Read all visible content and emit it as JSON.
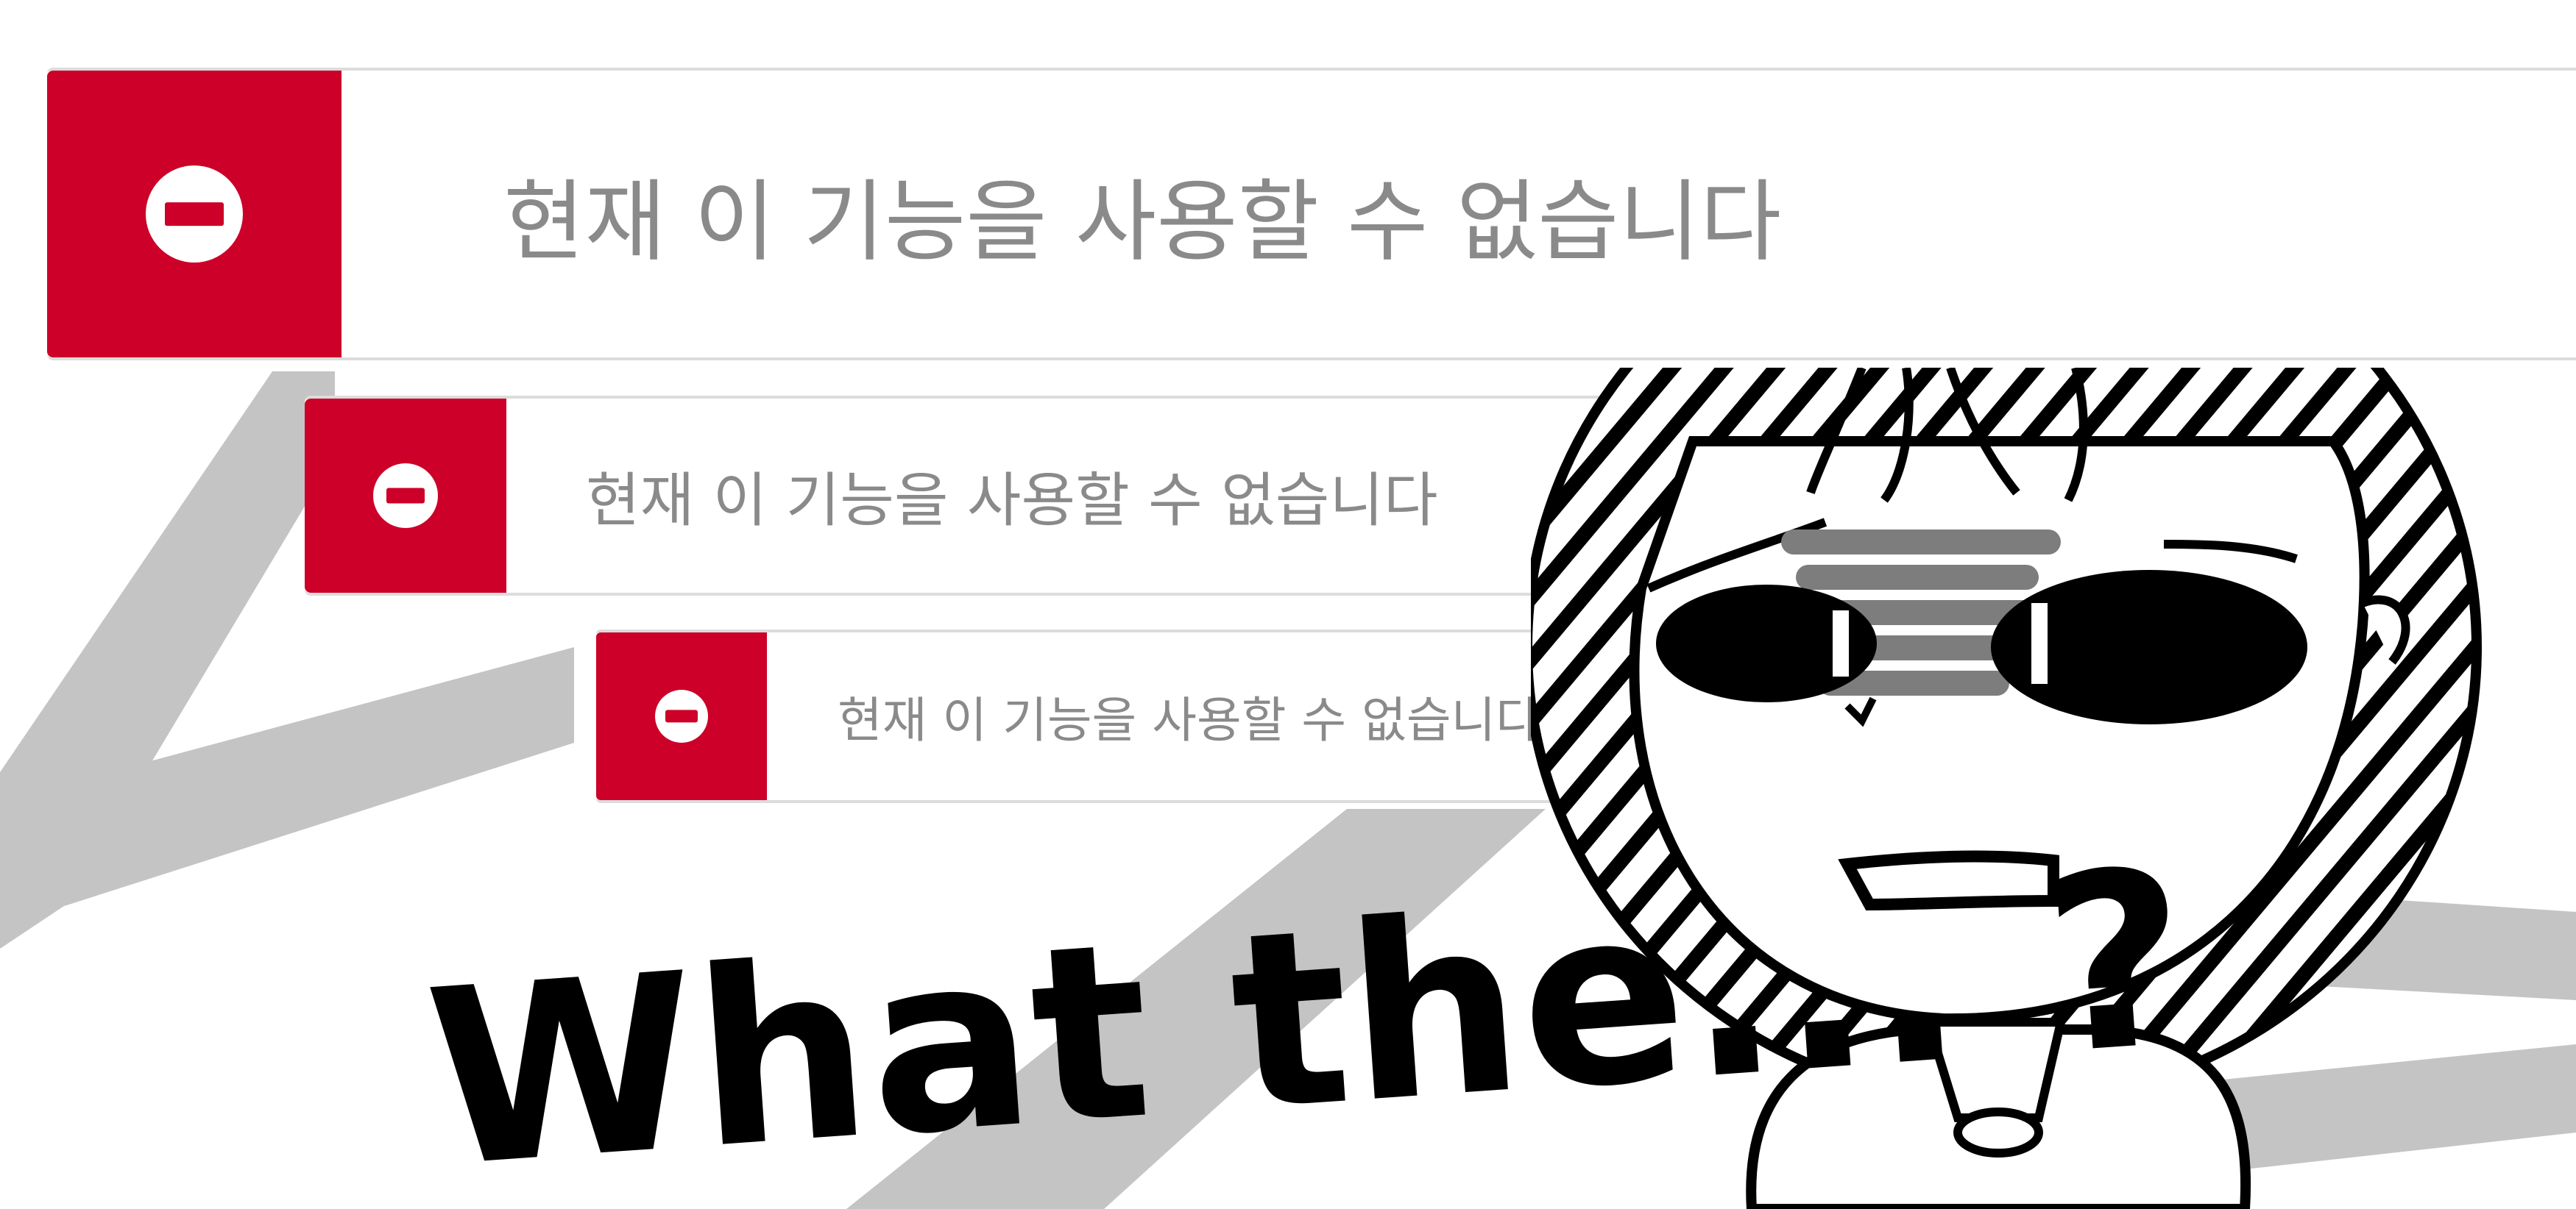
{
  "alerts": [
    {
      "message": "현재 이 기능을 사용할 수 없습니다",
      "icon": "no-entry-icon"
    },
    {
      "message": "현재 이 기능을 사용할 수 없습니다",
      "icon": "no-entry-icon"
    },
    {
      "message": "현재 이 기능을 사용할 수 없습니다",
      "icon": "no-entry-icon"
    }
  ],
  "caption": "What the... ?",
  "colors": {
    "alert_red": "#cc0028",
    "alert_text": "#8a8a8a",
    "streak_gray": "#c4c4c4",
    "ink": "#000000"
  }
}
